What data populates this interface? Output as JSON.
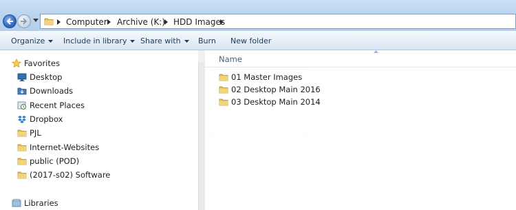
{
  "address": {
    "breadcrumbs": [
      "Computer",
      "Archive (K:)",
      "HDD Images"
    ]
  },
  "toolbar": {
    "organize": "Organize",
    "include_in_library": "Include in library",
    "share_with": "Share with",
    "burn": "Burn",
    "new_folder": "New folder"
  },
  "sidebar": {
    "favorites": "Favorites",
    "items": [
      {
        "label": "Desktop",
        "icon": "desktop-icon"
      },
      {
        "label": "Downloads",
        "icon": "downloads-icon"
      },
      {
        "label": "Recent Places",
        "icon": "recent-places-icon"
      },
      {
        "label": "Dropbox",
        "icon": "dropbox-icon"
      },
      {
        "label": "PJL",
        "icon": "folder-icon"
      },
      {
        "label": "Internet-Websites",
        "icon": "folder-icon"
      },
      {
        "label": "public (POD)",
        "icon": "folder-icon"
      },
      {
        "label": "(2017-s02) Software",
        "icon": "folder-icon"
      }
    ],
    "libraries": "Libraries"
  },
  "content": {
    "column_name": "Name",
    "files": [
      {
        "label": "01 Master Images",
        "icon": "folder-icon"
      },
      {
        "label": "02 Desktop Main 2016",
        "icon": "folder-icon"
      },
      {
        "label": "03 Desktop Main 2014",
        "icon": "folder-icon"
      }
    ]
  },
  "colors": {
    "address_strip": "#b8d3ee",
    "command_text": "#1e395b",
    "folder_yellow": "#e8c35a"
  }
}
